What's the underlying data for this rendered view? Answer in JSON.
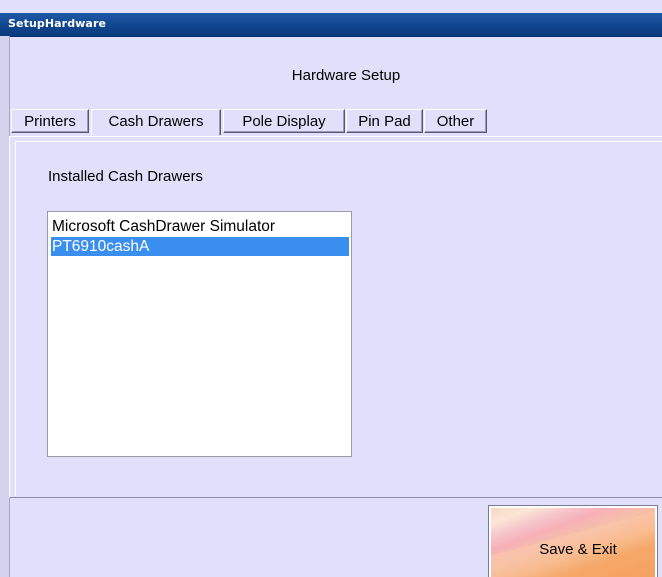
{
  "window": {
    "title": "SetupHardware"
  },
  "header": {
    "title": "Hardware Setup"
  },
  "tabs": [
    {
      "label": "Printers",
      "active": false
    },
    {
      "label": "Cash Drawers",
      "active": true
    },
    {
      "label": "Pole Display",
      "active": false
    },
    {
      "label": "Pin Pad",
      "active": false
    },
    {
      "label": "Other",
      "active": false
    }
  ],
  "cash_drawers": {
    "section_label": "Installed Cash Drawers",
    "items": [
      {
        "label": "Microsoft CashDrawer Simulator",
        "selected": false
      },
      {
        "label": "PT6910cashA",
        "selected": true
      }
    ]
  },
  "actions": {
    "save_exit_label": "Save & Exit"
  },
  "colors": {
    "titlebar": "#10458e",
    "window_bg": "#e0e0fa",
    "selection": "#3a8ef0",
    "save_button_accent": "#f4a060"
  }
}
